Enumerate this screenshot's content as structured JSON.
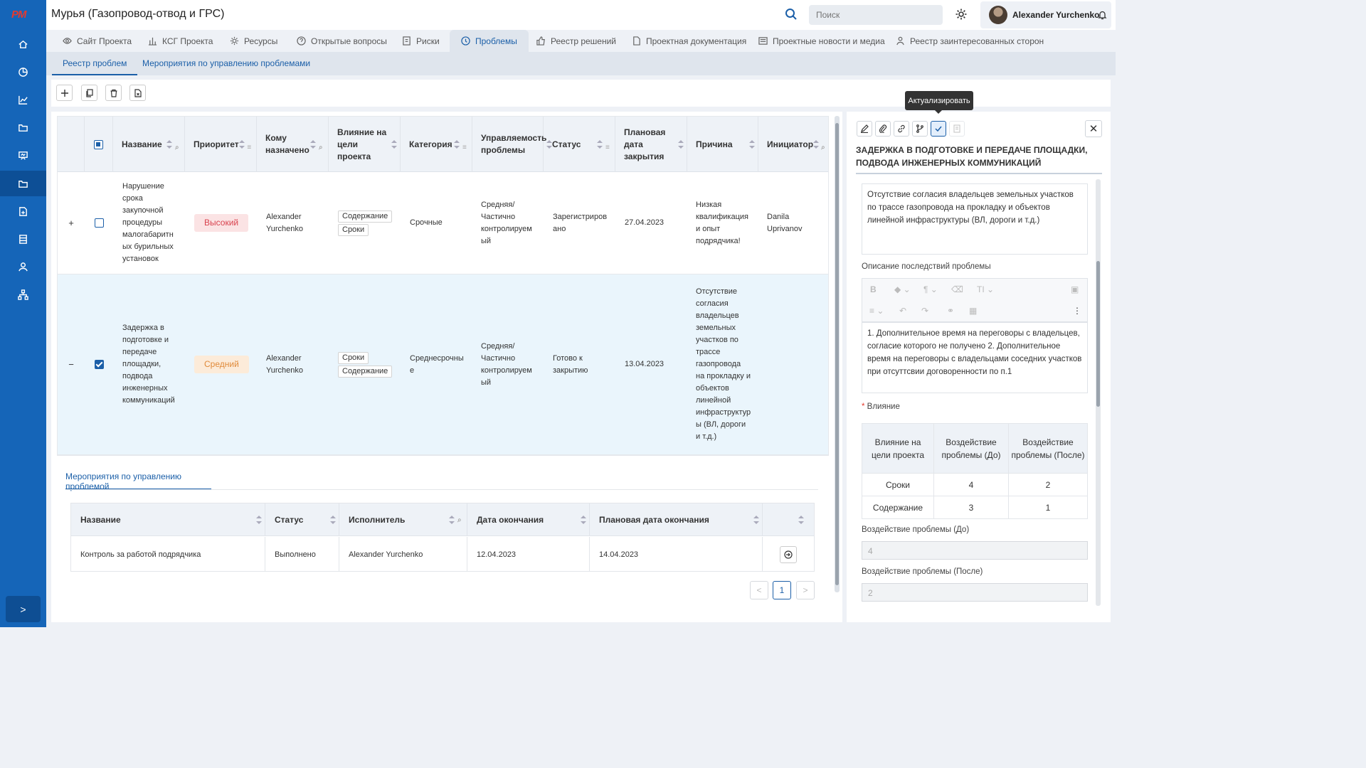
{
  "app": {
    "logo": "PM",
    "title": "Мурья (Газопровод-отвод и ГРС)"
  },
  "header": {
    "search_placeholder": "Поиск",
    "user_name": "Alexander Yurchenko"
  },
  "sidebar": {
    "icons": [
      "home-icon",
      "chart-pie-icon",
      "chart-line-icon",
      "folder-open-icon",
      "presentation-icon",
      "folder-icon",
      "document-add-icon",
      "list-icon",
      "user-icon",
      "hierarchy-icon"
    ],
    "active_index": 5
  },
  "tabs": [
    {
      "label": "Сайт Проекта",
      "icon": "eye-icon"
    },
    {
      "label": "КСГ Проекта",
      "icon": "bar-chart-icon"
    },
    {
      "label": "Ресурсы",
      "icon": "gear-icon"
    },
    {
      "label": "Открытые вопросы",
      "icon": "question-icon"
    },
    {
      "label": "Риски",
      "icon": "risk-icon"
    },
    {
      "label": "Проблемы",
      "icon": "problem-icon",
      "active": true
    },
    {
      "label": "Реестр решений",
      "icon": "thumb-icon"
    },
    {
      "label": "Проектная документация",
      "icon": "document-icon"
    },
    {
      "label": "Проектные новости и медиа",
      "icon": "news-icon"
    },
    {
      "label": "Реестр заинтересованных сторон",
      "icon": "stakeholder-icon"
    }
  ],
  "subtabs": [
    {
      "label": "Реестр проблем",
      "active": true
    },
    {
      "label": "Мероприятия по управлению проблемами"
    }
  ],
  "grid": {
    "columns": [
      "Название",
      "Приоритет",
      "Кому назначено",
      "Влияние на цели проекта",
      "Категория",
      "Управляемость проблемы",
      "Статус",
      "Плановая дата закрытия",
      "Причина",
      "Инициатор"
    ],
    "rows": [
      {
        "name": "Нарушение срока закупочной процедуры малогабаритн ых бурильных установок",
        "priority": "Высокий",
        "assignee": "Alexander Yurchenko",
        "impact": [
          "Содержание",
          "Сроки"
        ],
        "category": "Срочные",
        "manageability": "Средняя/ Частично контролируем ый",
        "status": "Зарегистриров ано",
        "date": "27.04.2023",
        "cause": "Низкая квалификация и опыт подрядчика!",
        "initiator": "Danila Uprivanov",
        "expand": "+",
        "checked": false
      },
      {
        "name": "Задержка в подготовке и передаче площадки, подвода инженерных коммуникаций",
        "priority": "Средний",
        "assignee": "Alexander Yurchenko",
        "impact": [
          "Сроки",
          "Содержание"
        ],
        "category": "Среднесрочны е",
        "manageability": "Средняя/ Частично контролируем ый",
        "status": "Готово к закрытию",
        "date": "13.04.2023",
        "cause": "Отсутствие согласия владельцев земельных участков по трассе газопровода на прокладку и объектов линейной инфраструктур ы (ВЛ, дороги и т.д.)",
        "initiator": "",
        "expand": "−",
        "checked": true
      }
    ]
  },
  "measures": {
    "tab": "Мероприятия по управлению проблемой",
    "columns": [
      "Название",
      "Статус",
      "Исполнитель",
      "Дата окончания",
      "Плановая дата окончания"
    ],
    "rows": [
      {
        "name": "Контроль за работой подрядчика",
        "status": "Выполнено",
        "executor": "Alexander Yurchenko",
        "end": "12.04.2023",
        "planned_end": "14.04.2023"
      }
    ],
    "page": "1"
  },
  "detail": {
    "tooltip": "Актуализировать",
    "title": "Задержка в подготовке и передаче площадки, подвода инженерных коммуникаций",
    "cause_text": "Отсутствие согласия владельцев земельных участков по трассе газопровода на прокладку и объектов линейной инфраструктуры (ВЛ, дороги и т.д.)",
    "consequences_label": "Описание последствий проблемы",
    "consequences_text": "1. Дополнительное время на переговоры с владельцев, согласие которого не получено 2. Дополнительное время на переговоры с владельцами соседних участков при отсуттсвии договоренности по п.1",
    "impact_label": "Влияние",
    "impact_table": {
      "headers": [
        "Влияние на цели проекта",
        "Воздействие проблемы (До)",
        "Воздействие проблемы (После)"
      ],
      "rows": [
        [
          "Сроки",
          "4",
          "2"
        ],
        [
          "Содержание",
          "3",
          "1"
        ]
      ]
    },
    "before_label": "Воздействие проблемы (До)",
    "before_value": "4",
    "after_label": "Воздействие проблемы (После)",
    "after_value": "2"
  },
  "colors": {
    "sidebar": "#1565b8",
    "accent": "#1b5fa8",
    "high": "#d9434f",
    "medium": "#e08a3a"
  }
}
